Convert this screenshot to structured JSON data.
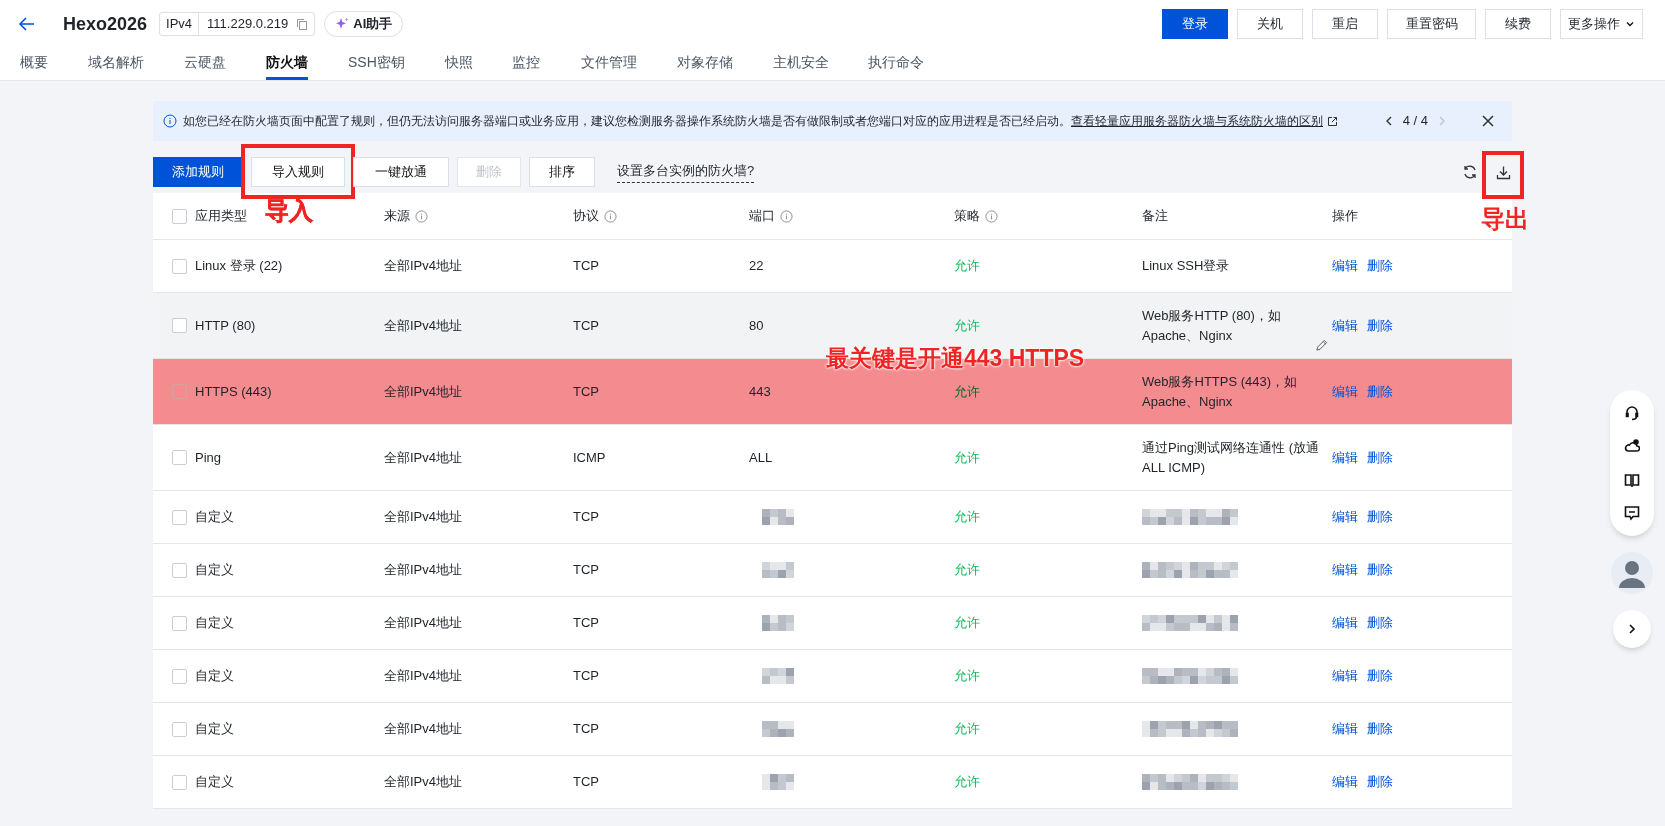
{
  "header": {
    "title": "Hexo2026",
    "ip_type": "IPv4",
    "ip": "111.229.0.219",
    "ai_button": "AI助手",
    "buttons": [
      {
        "label": "登录",
        "kind": "primary"
      },
      {
        "label": "关机",
        "kind": "default"
      },
      {
        "label": "重启",
        "kind": "default"
      },
      {
        "label": "重置密码",
        "kind": "default"
      },
      {
        "label": "续费",
        "kind": "default"
      },
      {
        "label": "更多操作",
        "kind": "dropdown"
      }
    ]
  },
  "tabs": [
    {
      "label": "概要",
      "selected": false
    },
    {
      "label": "域名解析",
      "selected": false
    },
    {
      "label": "云硬盘",
      "selected": false
    },
    {
      "label": "防火墙",
      "selected": true
    },
    {
      "label": "SSH密钥",
      "selected": false
    },
    {
      "label": "快照",
      "selected": false
    },
    {
      "label": "监控",
      "selected": false
    },
    {
      "label": "文件管理",
      "selected": false
    },
    {
      "label": "对象存储",
      "selected": false
    },
    {
      "label": "主机安全",
      "selected": false
    },
    {
      "label": "执行命令",
      "selected": false
    }
  ],
  "notice": {
    "text": "如您已经在防火墙页面中配置了规则，但仍无法访问服务器端口或业务应用，建议您检测服务器操作系统防火墙是否有做限制或者您端口对应的应用进程是否已经启动。",
    "link": "查看轻量应用服务器防火墙与系统防火墙的区别",
    "pager": "4 / 4",
    "prev_disabled": false,
    "next_disabled": true
  },
  "toolbar": {
    "buttons": [
      {
        "label": "添加规则",
        "kind": "primary"
      },
      {
        "label": "导入规则",
        "kind": "default",
        "annotation": "导入"
      },
      {
        "label": "一键放通",
        "kind": "default"
      },
      {
        "label": "删除",
        "kind": "disabled"
      },
      {
        "label": "排序",
        "kind": "default"
      }
    ],
    "link": "设置多台实例的防火墙?",
    "export_annotation": "导出"
  },
  "annotations": {
    "note": "最关键是开通443 HTTPS"
  },
  "table": {
    "all_checked": false,
    "columns": [
      {
        "label": "应用类型",
        "info": false
      },
      {
        "label": "来源",
        "info": true
      },
      {
        "label": "协议",
        "info": true
      },
      {
        "label": "端口",
        "info": true
      },
      {
        "label": "策略",
        "info": true
      },
      {
        "label": "备注",
        "info": false
      },
      {
        "label": "操作",
        "info": false
      }
    ],
    "rows": [
      {
        "checked": false,
        "hovered": false,
        "highlighted": false,
        "type": "Linux 登录 (22)",
        "source": "全部IPv4地址",
        "protocol": "TCP",
        "port": "22",
        "policy": "允许",
        "remark": "Linux SSH登录",
        "actions": [
          "编辑",
          "删除"
        ]
      },
      {
        "checked": false,
        "hovered": true,
        "highlighted": false,
        "type": "HTTP (80)",
        "source": "全部IPv4地址",
        "protocol": "TCP",
        "port": "80",
        "policy": "允许",
        "remark": "Web服务HTTP (80)，如Apache、Nginx",
        "actions": [
          "编辑",
          "删除"
        ]
      },
      {
        "checked": false,
        "hovered": false,
        "highlighted": true,
        "type": "HTTPS (443)",
        "source": "全部IPv4地址",
        "protocol": "TCP",
        "port": "443",
        "policy": "允许",
        "remark": "Web服务HTTPS (443)，如Apache、Nginx",
        "actions": [
          "编辑",
          "删除"
        ]
      },
      {
        "checked": false,
        "hovered": false,
        "highlighted": false,
        "type": "Ping",
        "source": "全部IPv4地址",
        "protocol": "ICMP",
        "port": "ALL",
        "policy": "允许",
        "remark": "通过Ping测试网络连通性 (放通ALL ICMP)",
        "actions": [
          "编辑",
          "删除"
        ]
      },
      {
        "checked": false,
        "hovered": false,
        "highlighted": false,
        "type": "自定义",
        "source": "全部IPv4地址",
        "protocol": "TCP",
        "redacted": true,
        "policy": "允许",
        "actions": [
          "编辑",
          "删除"
        ]
      },
      {
        "checked": false,
        "hovered": false,
        "highlighted": false,
        "type": "自定义",
        "source": "全部IPv4地址",
        "protocol": "TCP",
        "redacted": true,
        "policy": "允许",
        "actions": [
          "编辑",
          "删除"
        ]
      },
      {
        "checked": false,
        "hovered": false,
        "highlighted": false,
        "type": "自定义",
        "source": "全部IPv4地址",
        "protocol": "TCP",
        "redacted": true,
        "policy": "允许",
        "actions": [
          "编辑",
          "删除"
        ]
      },
      {
        "checked": false,
        "hovered": false,
        "highlighted": false,
        "type": "自定义",
        "source": "全部IPv4地址",
        "protocol": "TCP",
        "redacted": true,
        "policy": "允许",
        "actions": [
          "编辑",
          "删除"
        ]
      },
      {
        "checked": false,
        "hovered": false,
        "highlighted": false,
        "type": "自定义",
        "source": "全部IPv4地址",
        "protocol": "TCP",
        "redacted": true,
        "policy": "允许",
        "actions": [
          "编辑",
          "删除"
        ]
      },
      {
        "checked": false,
        "hovered": false,
        "highlighted": false,
        "type": "自定义",
        "source": "全部IPv4地址",
        "protocol": "TCP",
        "redacted": true,
        "policy": "允许",
        "actions": [
          "编辑",
          "删除"
        ]
      }
    ]
  }
}
